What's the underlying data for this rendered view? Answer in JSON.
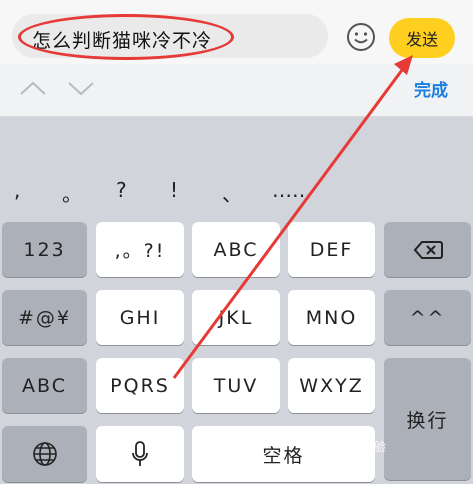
{
  "input": {
    "text": "怎么判断猫咪冷不冷"
  },
  "header": {
    "send_label": "发送",
    "emoji_icon": "smiley-icon"
  },
  "toolbar": {
    "done_label": "完成",
    "up_icon": "chevron-up-icon",
    "down_icon": "chevron-down-icon"
  },
  "punctuation": [
    ",",
    "。",
    "?",
    "!",
    "、",
    "……"
  ],
  "keys": {
    "num": "123",
    "punct": ",。?!",
    "abc": "ABC",
    "def": "DEF",
    "symbols": "#@¥",
    "ghi": "GHI",
    "jkl": "JKL",
    "mno": "MNO",
    "emoticon": "^^",
    "abc_mode": "ABC",
    "pqrs": "PQRS",
    "tuv": "TUV",
    "wxyz": "WXYZ",
    "newline": "换行",
    "space": "空格"
  },
  "watermark": {
    "text": "Baidu 经验"
  },
  "colors": {
    "send": "#ffcf1f",
    "done": "#1a7fe0",
    "annotation": "#e53a36"
  }
}
